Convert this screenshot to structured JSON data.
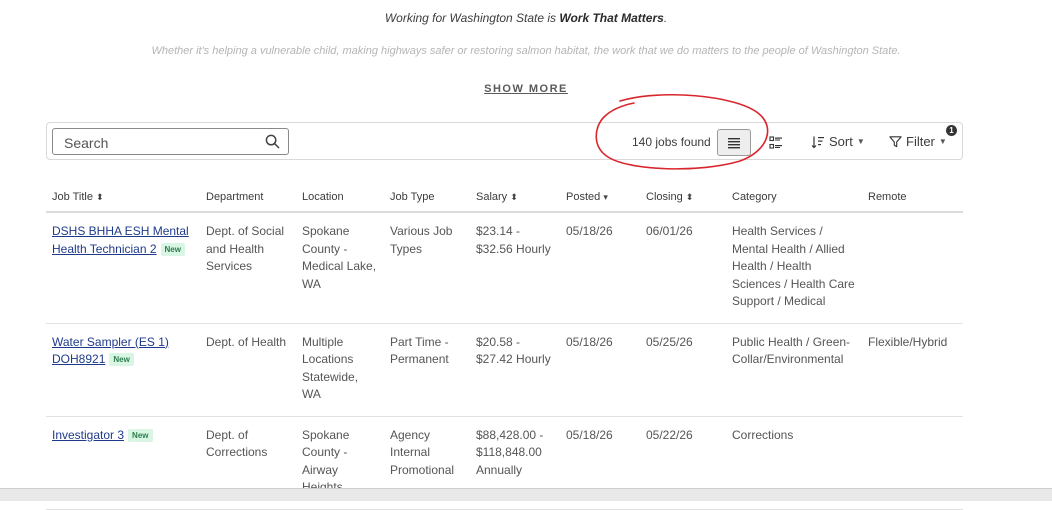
{
  "intro": {
    "line_prefix": "Working for Washington State is ",
    "line_bold": "Work That Matters",
    "line_suffix": ".",
    "subtext": "Whether it's helping a vulnerable child, making highways safer or restoring salmon habitat, the work that we do matters to the people of Washington State.",
    "show_more_label": "SHOW MORE"
  },
  "toolbar": {
    "search_placeholder": "Search",
    "search_value": "",
    "jobs_found": "140 jobs found",
    "sort_label": "Sort",
    "filter_label": "Filter",
    "filter_count": "1",
    "annotation_color": "#d9262c"
  },
  "table": {
    "headers": {
      "title": "Job Title",
      "department": "Department",
      "location": "Location",
      "job_type": "Job Type",
      "salary": "Salary",
      "posted": "Posted",
      "closing": "Closing",
      "category": "Category",
      "remote": "Remote"
    },
    "rows": [
      {
        "title": "DSHS BHHA ESH Mental Health Technician 2",
        "badge": "New",
        "department": "Dept. of Social and Health Services",
        "location": "Spokane County - Medical Lake, WA",
        "job_type": "Various Job Types",
        "salary": "$23.14 - $32.56 Hourly",
        "posted": "05/18/26",
        "closing": "06/01/26",
        "category": "Health Services / Mental Health / Allied Health / Health Sciences / Health Care Support / Medical",
        "remote": ""
      },
      {
        "title": "Water Sampler (ES 1) DOH8921",
        "badge": "New",
        "department": "Dept. of Health",
        "location": "Multiple Locations Statewide, WA",
        "job_type": "Part Time - Permanent",
        "salary": "$20.58 - $27.42 Hourly",
        "posted": "05/18/26",
        "closing": "05/25/26",
        "category": "Public Health / Green-Collar/Environmental",
        "remote": "Flexible/Hybrid"
      },
      {
        "title": "Investigator 3",
        "badge": "New",
        "department": "Dept. of Corrections",
        "location": "Spokane County - Airway Heights",
        "job_type": "Agency Internal Promotional",
        "salary": "$88,428.00 - $118,848.00 Annually",
        "posted": "05/18/26",
        "closing": "05/22/26",
        "category": "Corrections",
        "remote": ""
      }
    ]
  }
}
